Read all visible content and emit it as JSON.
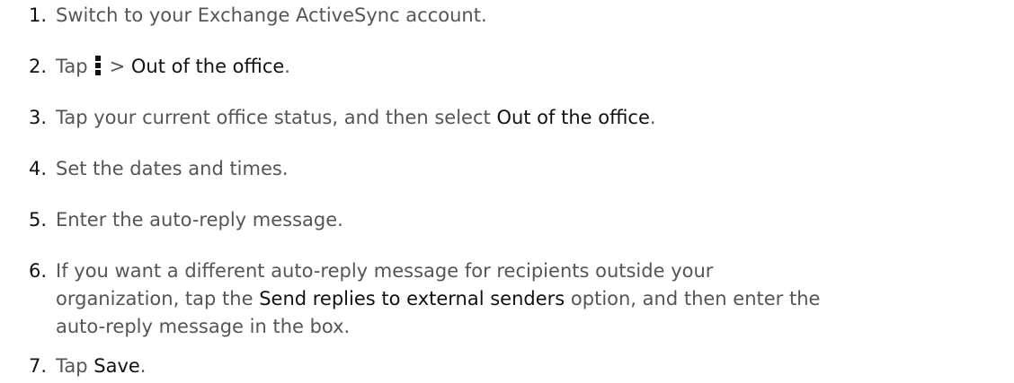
{
  "steps": [
    {
      "number": "1.",
      "text": "Switch to your Exchange ActiveSync account."
    },
    {
      "number": "2.",
      "pre": "Tap",
      "icon": "more-vertical-icon",
      "sep": ">",
      "action": "Out of the office",
      "post": "."
    },
    {
      "number": "3.",
      "pre": "Tap your current office status, and then select",
      "action": "Out of the office",
      "post": "."
    },
    {
      "number": "4.",
      "text": "Set the dates and times."
    },
    {
      "number": "5.",
      "text": "Enter the auto-reply message."
    },
    {
      "number": "6.",
      "line1": "If you want a different auto-reply message for recipients outside your",
      "line2_pre": "organization, tap the",
      "action": "Send replies to external senders",
      "line2_post": "option, and then enter the",
      "line3": "auto-reply message in the box."
    },
    {
      "number": "7.",
      "pre": "Tap",
      "action": "Save",
      "post": "."
    }
  ]
}
